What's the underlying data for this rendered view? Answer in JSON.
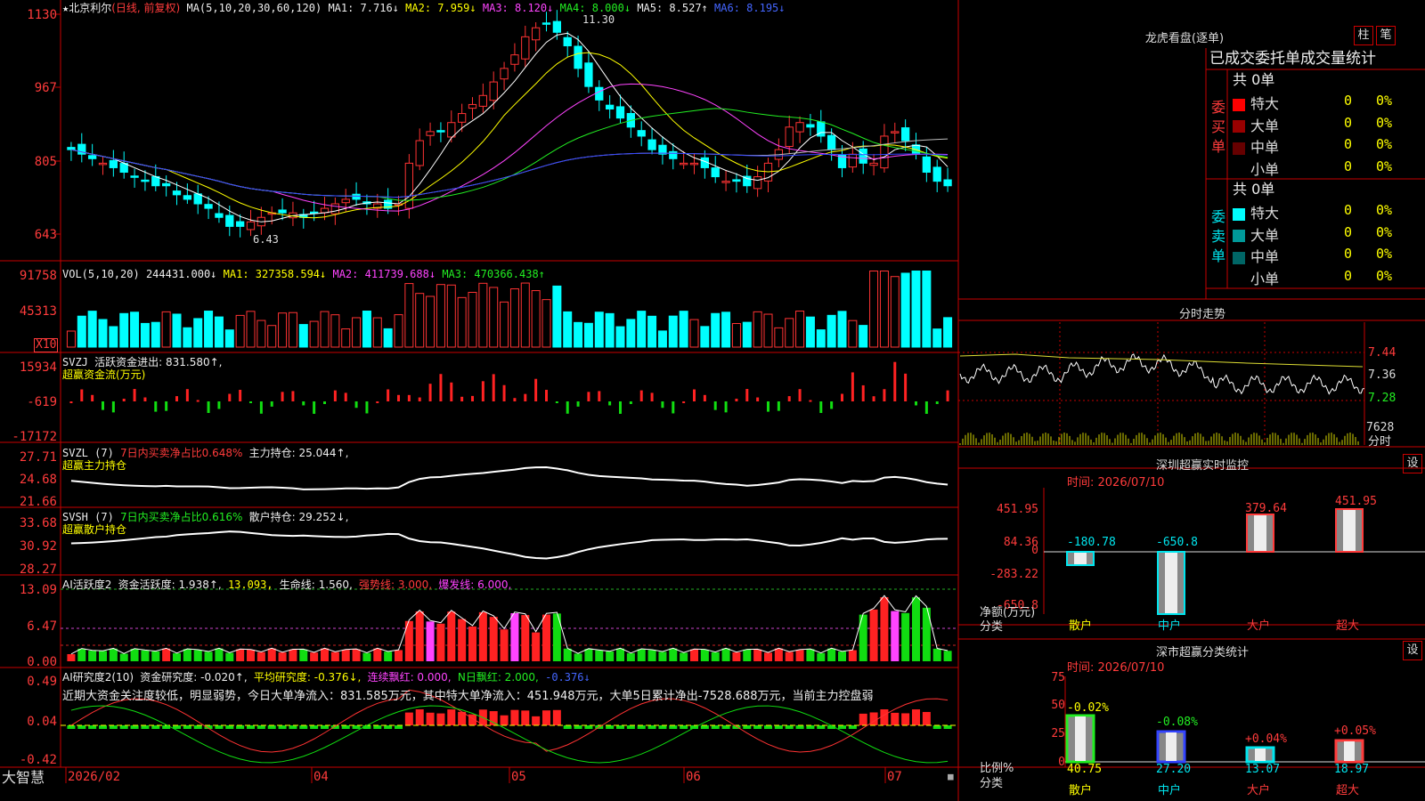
{
  "stock": {
    "star": "★",
    "name": "北京利尔",
    "mode": "(日线, 前复权)"
  },
  "main_header": {
    "ma_label": "MA(5,10,20,30,60,120)",
    "ma1": "MA1: 7.716↓",
    "ma2": "MA2: 7.959↓",
    "ma3": "MA3: 8.120↓",
    "ma4": "MA4: 8.000↓",
    "ma5": "MA5: 8.527↑",
    "ma6": "MA6: 8.195↓"
  },
  "main_axis": [
    "1130",
    "967",
    "805",
    "643"
  ],
  "main_annotations": {
    "high": "11.30",
    "low": "6.43"
  },
  "vol_header": {
    "label": "VOL(5,10,20)",
    "value": "244431.000↓",
    "ma1": "MA1: 327358.594↓",
    "ma2": "MA2: 411739.688↓",
    "ma3": "MA3: 470366.438↑"
  },
  "vol_axis": [
    "91758",
    "45313"
  ],
  "vol_unit": "X10",
  "svzj_header": {
    "label": "SVZJ",
    "text": "活跃资金进出: 831.580↑,",
    "sub": "超赢资金流(万元)"
  },
  "svzj_axis": [
    "15934",
    "-619",
    "-17172"
  ],
  "svzl_header": {
    "label": "SVZL (7)",
    "text1": "7日内买卖净占比0.648%",
    "text2": "主力持仓: 25.044↑,",
    "sub": "超赢主力持仓"
  },
  "svzl_axis": [
    "27.71",
    "24.68",
    "21.66"
  ],
  "svsh_header": {
    "label": "SVSH (7)",
    "text1": "7日内买卖净占比0.616%",
    "text2": "散户持仓: 29.252↓,",
    "sub": "超赢散户持仓"
  },
  "svsh_axis": [
    "33.68",
    "30.92",
    "28.27"
  ],
  "ai1_header": {
    "label": "AI活跃度2",
    "t1": "资金活跃度: 1.938↑,",
    "t2": "13.093,",
    "t3": "生命线: 1.560,",
    "t4": "强势线: 3.000,",
    "t5": "爆发线: 6.000,"
  },
  "ai1_axis": [
    "13.09",
    "6.47",
    "0.00"
  ],
  "ai2_header": {
    "label": "AI研究度2(10)",
    "t1": "资金研究度: -0.020↑,",
    "t2": "平均研究度: -0.376↓,",
    "t3": "连续飘红: 0.000,",
    "t4": "N日飘红: 2.000,",
    "t5": "-0.376↓"
  },
  "ai2_text": "近期大资金关注度较低，明显弱势，今日大单净流入：831.585万元，其中特大单净流入：451.948万元，大单5日累计净出-7528.688万元，当前主力控盘弱",
  "ai2_axis": [
    "0.49",
    "0.04",
    "-0.42"
  ],
  "footer": {
    "brand": "大智慧",
    "dates": [
      "2026/02",
      "04",
      "05",
      "06",
      "07"
    ]
  },
  "dragon": {
    "title": "龙虎看盘(逐单)",
    "btn1": "柱",
    "btn2": "笔",
    "subtitle": "已成交委托单成交量统计",
    "buy_label": "委买单",
    "sell_label": "委卖单",
    "buy_total": "共 0单",
    "sell_total": "共 0单",
    "buy_rows": [
      {
        "name": "特大",
        "v": "0",
        "p": "0%",
        "color": "#ff0000"
      },
      {
        "name": "大单",
        "v": "0",
        "p": "0%",
        "color": "#990000"
      },
      {
        "name": "中单",
        "v": "0",
        "p": "0%",
        "color": "#660000"
      },
      {
        "name": "小单",
        "v": "0",
        "p": "0%",
        "color": "#000000"
      }
    ],
    "sell_rows": [
      {
        "name": "特大",
        "v": "0",
        "p": "0%",
        "color": "#00ffff"
      },
      {
        "name": "大单",
        "v": "0",
        "p": "0%",
        "color": "#009999"
      },
      {
        "name": "中单",
        "v": "0",
        "p": "0%",
        "color": "#006666"
      },
      {
        "name": "小单",
        "v": "0",
        "p": "0%",
        "color": "#000000"
      }
    ]
  },
  "intraday": {
    "title": "分时走势",
    "axis": [
      "7.44",
      "7.36",
      "7.28"
    ],
    "vol": "7628",
    "unit": "分时"
  },
  "monitor": {
    "title": "深圳超赢实时监控",
    "btn": "设",
    "time": "时间: 2026/07/10",
    "axis": [
      "451.95",
      "84.36",
      "0",
      "-283.22",
      "-650.8"
    ],
    "unit": "净额(万元)",
    "cat_label": "分类",
    "cats": [
      "散户",
      "中户",
      "大户",
      "超大"
    ],
    "values": [
      "-180.78",
      "-650.8",
      "379.64",
      "451.95"
    ]
  },
  "classstat": {
    "title": "深市超赢分类统计",
    "btn": "设",
    "time": "时间: 2026/07/10",
    "axis": [
      "75",
      "50",
      "25",
      "0"
    ],
    "unit": "比例%",
    "cat_label": "分类",
    "cats": [
      "散户",
      "中户",
      "大户",
      "超大"
    ],
    "top": [
      "-0.02%",
      "-0.08%",
      "+0.04%",
      "+0.05%"
    ],
    "bottom": [
      "40.75",
      "27.20",
      "13.07",
      "18.97"
    ]
  },
  "chart_data": {
    "type": "candlestick",
    "title": "北京利尔",
    "price_range": [
      6.43,
      11.3
    ],
    "key_points": [
      {
        "label": "high",
        "y": 11.3
      },
      {
        "label": "low",
        "y": 6.43
      }
    ],
    "x_labels": [
      "2026/02",
      "04",
      "05",
      "06",
      "07"
    ],
    "closes": [
      8.3,
      8.2,
      8.1,
      8.0,
      7.9,
      7.8,
      7.7,
      7.6,
      7.5,
      7.5,
      7.3,
      7.2,
      7.1,
      7.0,
      6.8,
      6.6,
      6.6,
      6.7,
      6.8,
      6.9,
      6.9,
      6.9,
      6.8,
      6.9,
      7.0,
      7.1,
      7.2,
      7.2,
      7.1,
      7.1,
      7.0,
      7.1,
      8.0,
      8.5,
      8.7,
      8.7,
      8.9,
      9.1,
      9.3,
      9.5,
      9.8,
      10.1,
      10.4,
      10.8,
      11.0,
      11.1,
      10.9,
      10.6,
      10.1,
      9.7,
      9.4,
      9.2,
      9.0,
      8.8,
      8.6,
      8.3,
      8.2,
      8.1,
      8.0,
      8.0,
      7.9,
      7.7,
      7.6,
      7.6,
      7.5,
      7.7,
      8.0,
      8.3,
      8.8,
      8.9,
      8.8,
      8.6,
      8.3,
      7.9,
      8.2,
      8.0,
      8.0,
      8.6,
      8.7,
      8.5,
      8.2,
      7.8,
      7.6,
      7.5
    ]
  }
}
